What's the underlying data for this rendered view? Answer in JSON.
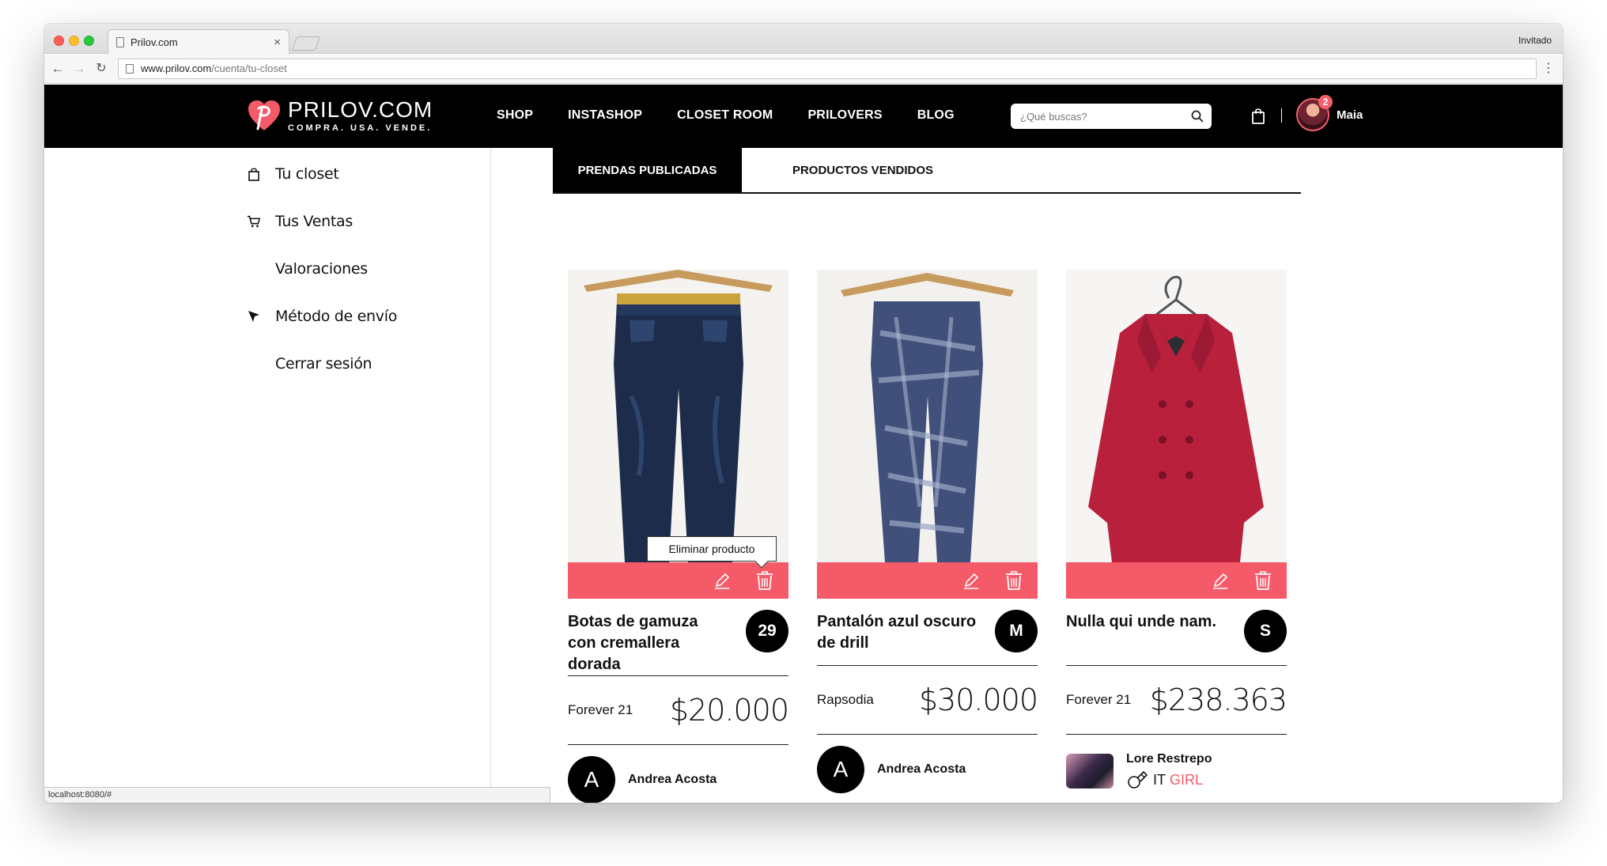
{
  "browser": {
    "tab_title": "Prilov.com",
    "tab_close": "×",
    "profile": "Invitado",
    "url_host": "www.prilov.com",
    "url_path": "/cuenta/tu-closet",
    "status_url": "localhost:8080/#"
  },
  "header": {
    "logo_name": "PRILOV.COM",
    "logo_tagline": "COMPRA. USA. VENDE.",
    "nav": [
      "SHOP",
      "INSTASHOP",
      "CLOSET ROOM",
      "PRILOVERS",
      "BLOG"
    ],
    "search_placeholder": "¿Qué buscas?",
    "notification_count": "2",
    "username": "Maia",
    "brand_color": "#f55a69"
  },
  "sidebar": {
    "items": [
      {
        "label": "Tu closet",
        "icon": "bag-icon"
      },
      {
        "label": "Tus Ventas",
        "icon": "cart-icon"
      },
      {
        "label": "Valoraciones",
        "icon": ""
      },
      {
        "label": "Método de envío",
        "icon": "arrow-pointer-icon"
      },
      {
        "label": "Cerrar sesión",
        "icon": ""
      }
    ]
  },
  "tabs": {
    "published": "PRENDAS PUBLICADAS",
    "sold": "PRODUCTOS VENDIDOS"
  },
  "tooltip": "Eliminar producto",
  "products": [
    {
      "title": "Botas de gamuza con cremallera dorada",
      "size": "29",
      "brand": "Forever 21",
      "price": "$20.000",
      "seller_initial": "A",
      "seller_name": "Andrea Acosta"
    },
    {
      "title": "Pantalón azul oscuro de drill",
      "size": "M",
      "brand": "Rapsodia",
      "price": "$30.000",
      "seller_initial": "A",
      "seller_name": "Andrea Acosta"
    },
    {
      "title": "Nulla qui unde nam.",
      "size": "S",
      "brand": "Forever 21",
      "price": "$238.363",
      "seller_name": "Lore Restrepo",
      "seller_tag_it": "IT",
      "seller_tag_girl": "GIRL"
    }
  ]
}
